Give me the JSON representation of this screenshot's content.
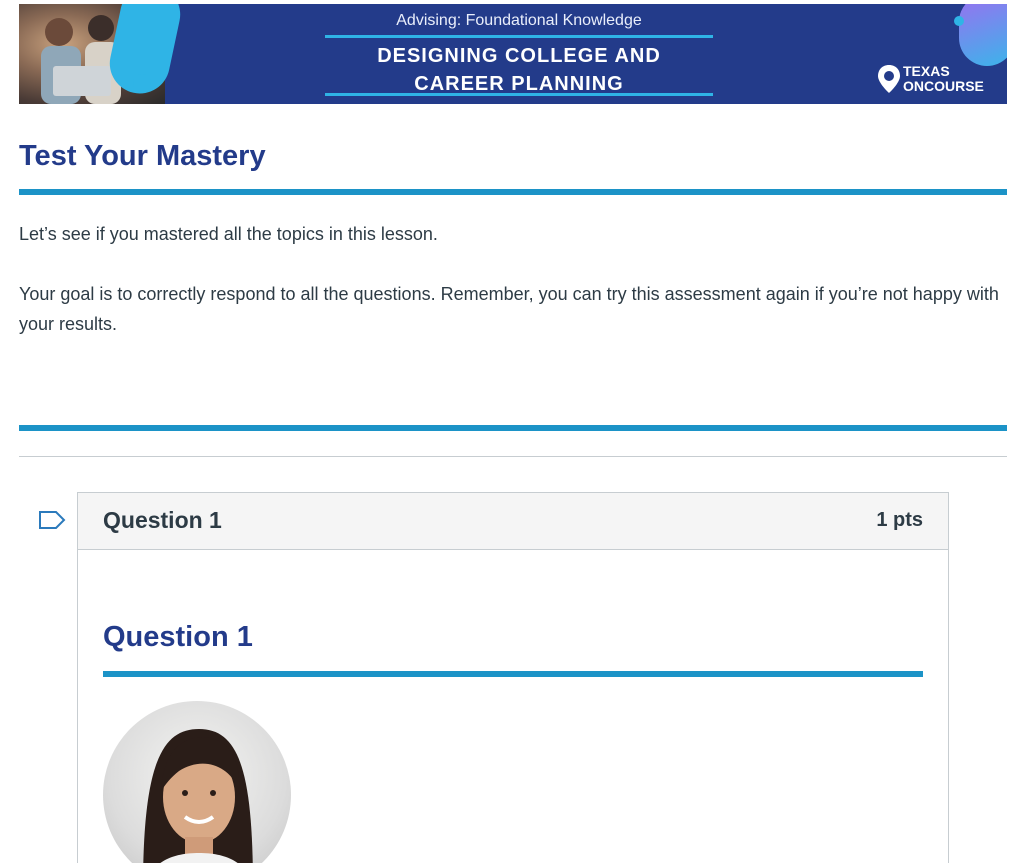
{
  "banner": {
    "subtitle": "Advising: Foundational Knowledge",
    "title_line1": "DESIGNING COLLEGE AND",
    "title_line2": "CAREER PLANNING",
    "brand_line1": "TEXAS",
    "brand_line2": "ONCOURSE",
    "brand_icon": "map-pin-icon",
    "photo": "students-at-laptop-photo"
  },
  "main": {
    "heading": "Test Your Mastery",
    "intro": "Let’s see if you mastered all the topics in this lesson.",
    "goal": "Your goal is to correctly respond to all the questions. Remember, you can try this assessment again if you’re not happy with your results."
  },
  "question": {
    "flag_icon": "bookmark-flag-icon",
    "header_title": "Question 1",
    "points": "1 pts",
    "heading": "Question 1",
    "image": "woman-portrait-avatar"
  },
  "colors": {
    "navy": "#233b8a",
    "accent": "#1c93c7",
    "text": "#2d3b45",
    "border": "#c7cdd1",
    "header_bg": "#f5f5f5"
  }
}
